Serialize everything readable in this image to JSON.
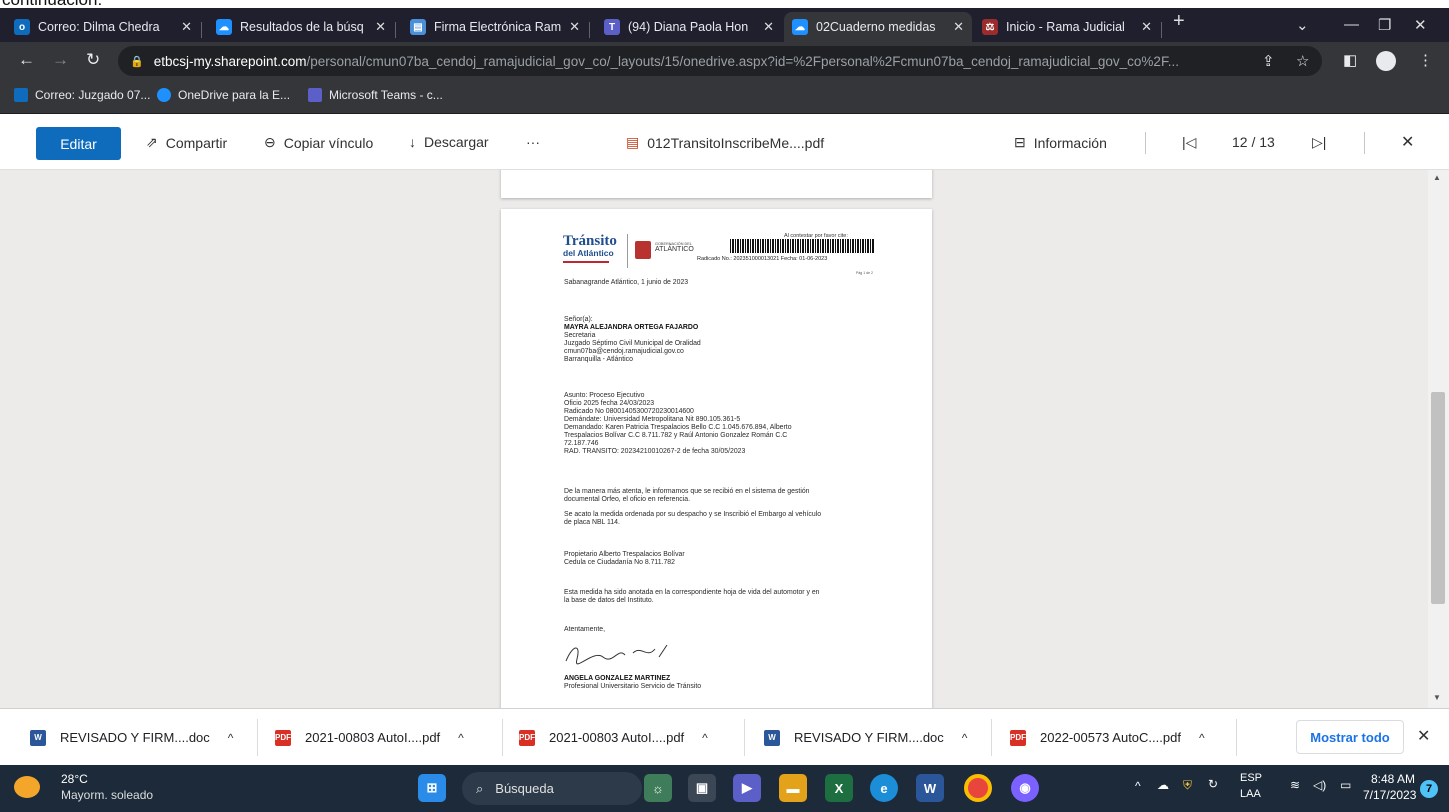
{
  "crop_text": "continuación:",
  "tabs": [
    {
      "label": "Correo: Dilma Chedra",
      "icon": "outlook-icon",
      "color": "#0f6cbd",
      "glyph": "o"
    },
    {
      "label": "Resultados de la búsq",
      "icon": "onedrive-icon",
      "color": "#0f6cbd",
      "glyph": "☁"
    },
    {
      "label": "Firma Electrónica Ram",
      "icon": "document-icon",
      "color": "#4a8fd8",
      "glyph": "▤"
    },
    {
      "label": "(94) Diana Paola Hon",
      "icon": "teams-icon",
      "color": "#5b5fc7",
      "glyph": "T"
    },
    {
      "label": "02Cuaderno medidas",
      "icon": "onedrive-icon",
      "color": "#0f6cbd",
      "glyph": "☁"
    },
    {
      "label": "Inicio - Rama Judicial",
      "icon": "rama-judicial-icon",
      "color": "#9b2c2c",
      "glyph": "⚖"
    }
  ],
  "address": {
    "domain": "etbcsj-my.sharepoint.com",
    "path": "/personal/cmun07ba_cendoj_ramajudicial_gov_co/_layouts/15/onedrive.aspx?id=%2Fpersonal%2Fcmun07ba_cendoj_ramajudicial_gov_co%2F..."
  },
  "bookmarks": [
    {
      "label": "Correo: Juzgado 07...",
      "color": "#0f6cbd"
    },
    {
      "label": "OneDrive para la E...",
      "color": "#1e90ff"
    },
    {
      "label": "Microsoft Teams - c...",
      "color": "#5b5fc7"
    }
  ],
  "toolbar": {
    "edit": "Editar",
    "share": "Compartir",
    "copy_link": "Copiar vínculo",
    "download": "Descargar",
    "more": "···",
    "filename": "012TransitoInscribeMe....pdf",
    "info": "Información",
    "page_indicator": "12 / 13"
  },
  "document": {
    "logo_main": "Tránsito",
    "logo_sub": "del Atlántico",
    "gov_small": "GOBERNACIÓN DEL",
    "gov_name": "ATLÁNTICO",
    "cite_label": "Al contestar por favor cite:",
    "radicado_line": "Radicado No.: 202351000013021 Fecha: 01-06-2023",
    "page_of": "Pág 1 de 2",
    "place_date": "Sabanagrande Atlántico, 1 junio de 2023",
    "salutation": "Señor(a):",
    "recipient_name": "MAYRA ALEJANDRA ORTEGA FAJARDO",
    "recipient_lines": [
      "Secretaria",
      "Juzgado Séptimo Civil Municipal de Oralidad",
      "cmun07ba@cendoj.ramajudicial.gov.co",
      "Barranquilla - Atlántico"
    ],
    "subject_lines": [
      "Asunto: Proceso Ejecutivo",
      "Oficio 2025 fecha 24/03/2023",
      "Radicado No 08001405300720230014600",
      "Demándate: Universidad Metropolitana Nit 890.105.361-5",
      "Demandado: Karen Patricia Trespalacios Bello C.C 1.045.676.894, Alberto",
      "Trespalacios Bolívar C.C 8.711.782 y Raúl Antonio Gonzalez Román C.C",
      "72.187.746",
      "RAD. TRANSITO: 20234210010267-2 de fecha 30/05/2023"
    ],
    "body1": [
      "De la manera más atenta, le informamos que se recibió en el sistema de gestión",
      "documental Orfeo, el oficio en referencia."
    ],
    "body2": [
      "Se acato la medida ordenada por su despacho y se Inscribió el Embargo al vehículo",
      "de placa NBL 114."
    ],
    "owner_lines": [
      "Propietario Alberto Trespalacios Bolívar",
      "Cedula ce Ciudadanía No 8.711.782"
    ],
    "body3": [
      "Esta medida ha sido anotada en la correspondiente hoja de vida del automotor y en",
      "la base de datos del Instituto."
    ],
    "closing": "Atentamente,",
    "signer_name": "ANGELA GONZALEZ MARTINEZ",
    "signer_title": "Profesional Universitario Servicio de Tránsito"
  },
  "downloads": [
    {
      "label": "REVISADO Y FIRM....doc",
      "type": "word"
    },
    {
      "label": "2021-00803 AutoI....pdf",
      "type": "pdf"
    },
    {
      "label": "2021-00803 AutoI....pdf",
      "type": "pdf"
    },
    {
      "label": "REVISADO Y FIRM....doc",
      "type": "word"
    },
    {
      "label": "2022-00573 AutoC....pdf",
      "type": "pdf"
    }
  ],
  "show_all": "Mostrar todo",
  "taskbar": {
    "weather_temp": "28°C",
    "weather_desc": "Mayorm. soleado",
    "search": "Búsqueda",
    "lang1": "ESP",
    "lang2": "LAA",
    "time": "8:48 AM",
    "date": "7/17/2023",
    "notif_count": "7"
  }
}
